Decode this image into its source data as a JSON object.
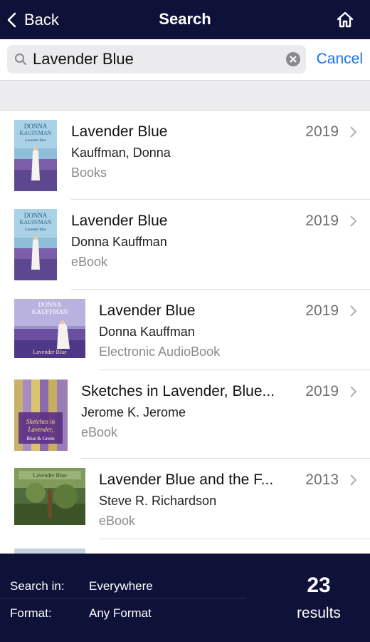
{
  "nav": {
    "back_label": "Back",
    "title": "Search"
  },
  "search": {
    "value": "Lavender Blue",
    "cancel_label": "Cancel"
  },
  "results": [
    {
      "title": "Lavender Blue",
      "author": "Kauffman, Donna",
      "format": "Books",
      "year": "2019"
    },
    {
      "title": "Lavender Blue",
      "author": "Donna Kauffman",
      "format": "eBook",
      "year": "2019"
    },
    {
      "title": "Lavender Blue",
      "author": "Donna Kauffman",
      "format": "Electronic AudioBook",
      "year": "2019"
    },
    {
      "title": "Sketches in Lavender, Blue...",
      "author": "Jerome K. Jerome",
      "format": "eBook",
      "year": "2019"
    },
    {
      "title": "Lavender Blue and the F...",
      "author": "Steve R. Richardson",
      "format": "eBook",
      "year": "2013"
    }
  ],
  "footer": {
    "search_in_label": "Search in:",
    "search_in_value": "Everywhere",
    "format_label": "Format:",
    "format_value": "Any Format",
    "count": "23",
    "count_label": "results"
  },
  "colors": {
    "nav_bg": "#0e1138",
    "link": "#1a73e8"
  }
}
